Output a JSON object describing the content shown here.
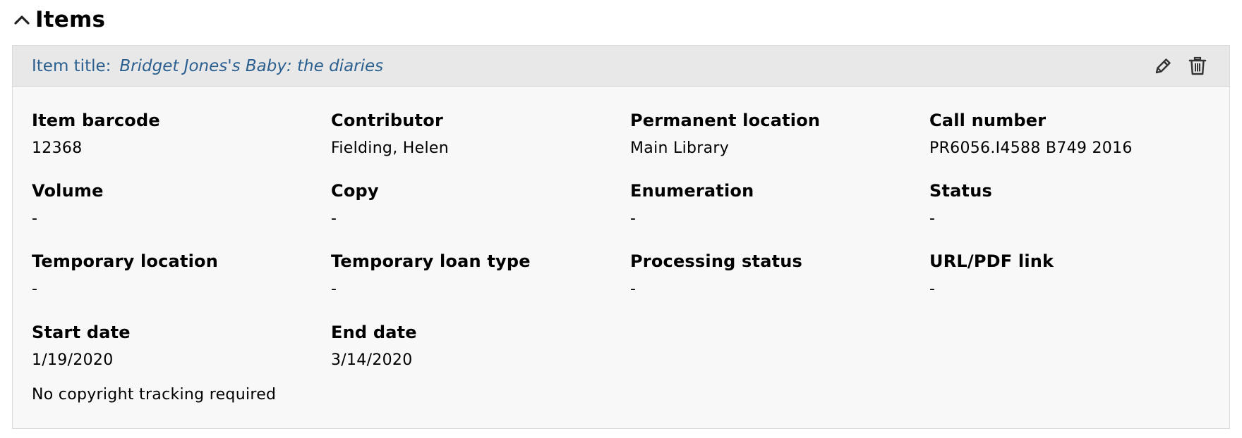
{
  "section": {
    "title": "Items"
  },
  "item": {
    "title_label": "Item title:",
    "title_value": "Bridget Jones's Baby: the diaries",
    "fields": [
      {
        "label": "Item barcode",
        "value": "12368"
      },
      {
        "label": "Contributor",
        "value": "Fielding, Helen"
      },
      {
        "label": "Permanent location",
        "value": "Main Library"
      },
      {
        "label": "Call number",
        "value": "PR6056.I4588 B749 2016"
      },
      {
        "label": "Volume",
        "value": "-"
      },
      {
        "label": "Copy",
        "value": "-"
      },
      {
        "label": "Enumeration",
        "value": "-"
      },
      {
        "label": "Status",
        "value": "-"
      },
      {
        "label": "Temporary location",
        "value": "-"
      },
      {
        "label": "Temporary loan type",
        "value": "-"
      },
      {
        "label": "Processing status",
        "value": "-"
      },
      {
        "label": "URL/PDF link",
        "value": "-"
      },
      {
        "label": "Start date",
        "value": "1/19/2020"
      },
      {
        "label": "End date",
        "value": "3/14/2020"
      }
    ],
    "copyright_note": "No copyright tracking required"
  },
  "icons": {
    "collapse": "chevron-up-icon",
    "edit": "pencil-icon",
    "delete": "trash-icon"
  },
  "colors": {
    "title_link": "#2b5f8f",
    "header_bg": "#e8e8e8",
    "card_bg": "#f8f8f8",
    "icon": "#333333"
  }
}
